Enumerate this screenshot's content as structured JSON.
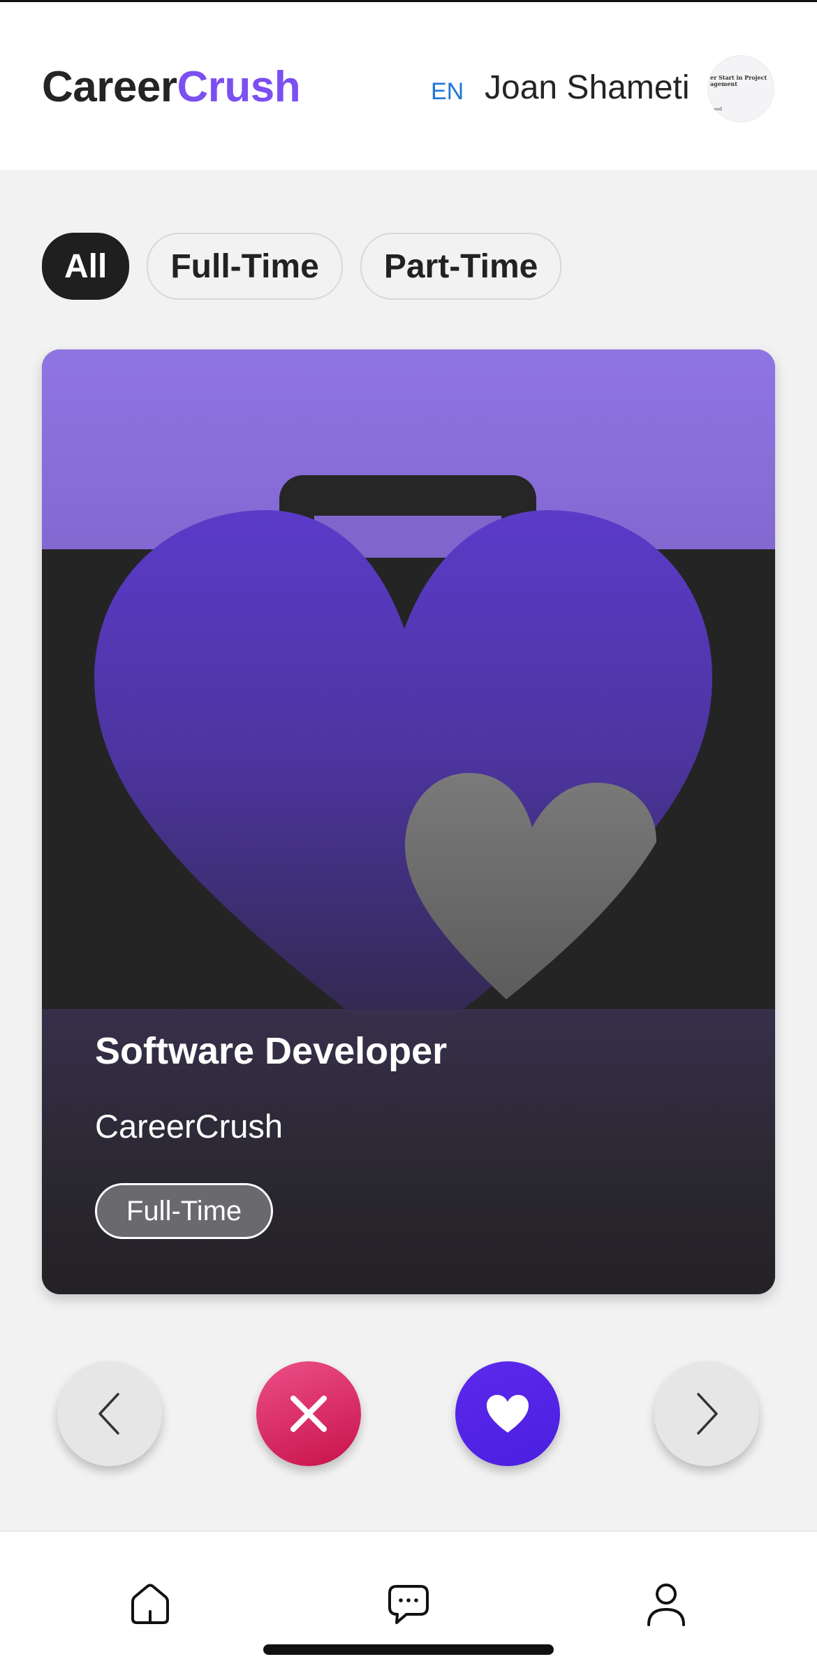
{
  "header": {
    "brand_part1": "Career",
    "brand_part2": "Crush",
    "language": "EN",
    "user_name": "Joan Shameti",
    "avatar_text_line1": "er Start in Project",
    "avatar_text_line2": "agement",
    "avatar_text_line3": "eed"
  },
  "filters": [
    {
      "label": "All",
      "active": true
    },
    {
      "label": "Full-Time",
      "active": false
    },
    {
      "label": "Part-Time",
      "active": false
    }
  ],
  "job_card": {
    "title": "Software Developer",
    "company": "CareerCrush",
    "type": "Full-Time"
  },
  "actions": {
    "previous_icon": "chevron-left-icon",
    "dislike_icon": "close-icon",
    "like_icon": "heart-icon",
    "next_icon": "chevron-right-icon"
  },
  "bottom_nav": {
    "home_icon": "home-icon",
    "messages_icon": "chat-icon",
    "profile_icon": "user-icon"
  },
  "colors": {
    "brand_accent": "#7b4ff0",
    "language_link": "#1f74d6",
    "dislike": "#d81f5d",
    "like": "#5225e8"
  }
}
